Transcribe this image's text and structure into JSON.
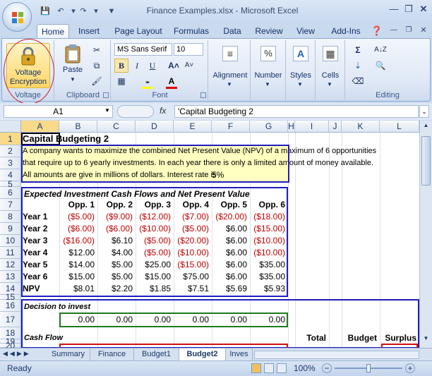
{
  "window": {
    "title": "Finance Examples.xlsx - Microsoft Excel"
  },
  "tabs": [
    "Home",
    "Insert",
    "Page Layout",
    "Formulas",
    "Data",
    "Review",
    "View",
    "Add-Ins"
  ],
  "ribbon": {
    "voltage": {
      "button": "Voltage Encryption",
      "label": "Voltage"
    },
    "clipboard": {
      "paste": "Paste",
      "label": "Clipboard"
    },
    "font": {
      "name": "MS Sans Serif",
      "size": "10",
      "label": "Font"
    },
    "alignment": "Alignment",
    "number": "Number",
    "styles": "Styles",
    "cells": "Cells",
    "editing": "Editing"
  },
  "formula_bar": {
    "name_box": "A1",
    "fx": "fx",
    "formula": "'Capital Budgeting 2"
  },
  "columns": [
    "A",
    "B",
    "C",
    "D",
    "E",
    "F",
    "G",
    "H",
    "I",
    "J",
    "K",
    "L"
  ],
  "rows": [
    "1",
    "2",
    "3",
    "4",
    "5",
    "6",
    "7",
    "8",
    "9",
    "10",
    "11",
    "12",
    "13",
    "14",
    "15",
    "16",
    "17",
    "18",
    "19",
    "20"
  ],
  "sheet": {
    "title": "Capital Budgeting 2",
    "desc1": "A company wants to maximize the combined Net Present Value (NPV) of a maximum of 6 opportunities",
    "desc2": "that require up to 6 yearly investments. In each year there is only a limited amount of money available.",
    "desc3": "All amounts are give in millions of dollars. Interest rate is",
    "rate": "5%",
    "cashflow_title": "Expected Investment Cash Flows and Net Present Value",
    "opp_headers": [
      "Opp. 1",
      "Opp. 2",
      "Opp. 3",
      "Opp. 4",
      "Opp. 5",
      "Opp. 6"
    ],
    "year_rows": [
      {
        "label": "Year 1",
        "values": [
          "($5.00)",
          "($9.00)",
          "($12.00)",
          "($7.00)",
          "($20.00)",
          "($18.00)"
        ]
      },
      {
        "label": "Year 2",
        "values": [
          "($6.00)",
          "($6.00)",
          "($10.00)",
          "($5.00)",
          "$6.00",
          "($15.00)"
        ]
      },
      {
        "label": "Year 3",
        "values": [
          "($16.00)",
          "$6.10",
          "($5.00)",
          "($20.00)",
          "$6.00",
          "($10.00)"
        ]
      },
      {
        "label": "Year 4",
        "values": [
          "$12.00",
          "$4.00",
          "($5.00)",
          "($10.00)",
          "$6.00",
          "($10.00)"
        ]
      },
      {
        "label": "Year 5",
        "values": [
          "$14.00",
          "$5.00",
          "$25.00",
          "($15.00)",
          "$6.00",
          "$35.00"
        ]
      },
      {
        "label": "Year 6",
        "values": [
          "$15.00",
          "$5.00",
          "$15.00",
          "$75.00",
          "$6.00",
          "$35.00"
        ]
      },
      {
        "label": "NPV",
        "values": [
          "$8.01",
          "$2.20",
          "$1.85",
          "$7.51",
          "$5.69",
          "$5.93"
        ]
      }
    ],
    "decision_title": "Decision to invest",
    "decisions": [
      "0.00",
      "0.00",
      "0.00",
      "0.00",
      "0.00",
      "0.00"
    ],
    "cashflow_label": "Cash Flow",
    "total": "Total",
    "budget": "Budget",
    "surplus": "Surplus"
  },
  "sheet_tabs": [
    "Summary",
    "Finance",
    "Budget1",
    "Budget2",
    "Inves"
  ],
  "status": {
    "ready": "Ready",
    "zoom": "100%"
  },
  "colors": {
    "accent": "#1f1fbf",
    "negative": "#c00000",
    "decision_box": "#1e7b1e",
    "cashflow_box": "#d01010"
  }
}
